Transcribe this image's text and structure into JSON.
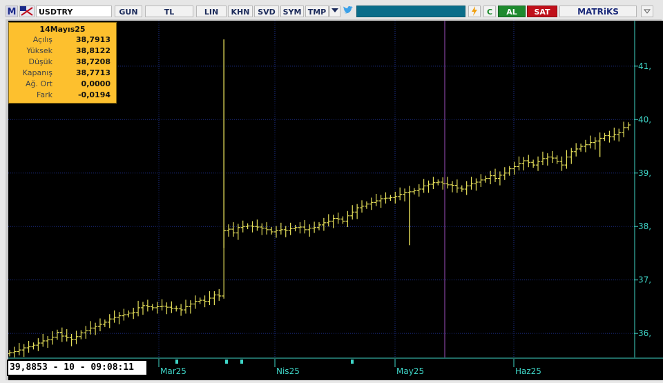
{
  "toolbar": {
    "logo": "M",
    "symbol": "USDTRY",
    "buttons": [
      "GUN",
      "TL",
      "LIN",
      "KHN",
      "SVD",
      "SYM",
      "TMP"
    ],
    "refresh": "C",
    "buy": "AL",
    "sell": "SAT",
    "brand": "MATRiKS"
  },
  "info_box": {
    "date": "14Mayıs25",
    "rows": [
      {
        "label": "Açılış",
        "value": "38,7913"
      },
      {
        "label": "Yüksek",
        "value": "38,8122"
      },
      {
        "label": "Düşük",
        "value": "38,7208"
      },
      {
        "label": "Kapanış",
        "value": "38,7713"
      },
      {
        "label": "Ağ. Ort",
        "value": "0,0000"
      },
      {
        "label": "Fark",
        "value": "-0,0194"
      }
    ]
  },
  "status": "39,8853 - 10 - 09:08:11",
  "colors": {
    "price": "#e6e05a",
    "grid": "#1e2f8a",
    "axis": "#3fd6c8",
    "cursor": "#a050c0"
  },
  "chart_data": {
    "type": "ohlc",
    "title": "USDTRY",
    "yticks": [
      {
        "value": 41,
        "label": "41,"
      },
      {
        "value": 40,
        "label": "40,"
      },
      {
        "value": 39,
        "label": "39,"
      },
      {
        "value": 38,
        "label": "38,"
      },
      {
        "value": 37,
        "label": "37,"
      },
      {
        "value": 36,
        "label": "36,"
      }
    ],
    "xticks": [
      "Mar25",
      "Nis25",
      "May25",
      "Haz25"
    ],
    "ylim": [
      35.55,
      41.85
    ],
    "grid": true,
    "closes": [
      35.64,
      35.66,
      35.69,
      35.73,
      35.75,
      35.78,
      35.82,
      35.86,
      35.88,
      35.93,
      36.02,
      35.95,
      35.92,
      35.89,
      35.94,
      36.01,
      36.05,
      36.1,
      36.13,
      36.17,
      36.21,
      36.27,
      36.3,
      36.33,
      36.35,
      36.38,
      36.39,
      36.48,
      36.52,
      36.5,
      36.48,
      36.5,
      36.51,
      36.49,
      36.47,
      36.46,
      36.44,
      36.5,
      36.55,
      36.6,
      36.62,
      36.6,
      36.66,
      36.72,
      36.7,
      37.92,
      37.95,
      37.88,
      37.98,
      38.0,
      38.01,
      38.0,
      37.99,
      37.97,
      37.94,
      37.9,
      37.92,
      37.94,
      37.93,
      37.96,
      37.98,
      37.99,
      37.94,
      37.97,
      37.98,
      38.03,
      38.07,
      38.1,
      38.15,
      38.14,
      38.1,
      38.2,
      38.27,
      38.35,
      38.38,
      38.42,
      38.45,
      38.48,
      38.52,
      38.53,
      38.54,
      38.56,
      38.6,
      38.64,
      38.65,
      38.67,
      38.7,
      38.76,
      38.79,
      38.82,
      38.83,
      38.8,
      38.78,
      38.77,
      38.72,
      38.7,
      38.76,
      38.8,
      38.83,
      38.87,
      38.9,
      38.95,
      38.9,
      38.96,
      39.0,
      39.08,
      39.12,
      39.18,
      39.23,
      39.2,
      39.15,
      39.22,
      39.27,
      39.3,
      39.28,
      39.22,
      39.15,
      39.3,
      39.4,
      39.45,
      39.5,
      39.53,
      39.57,
      39.6,
      39.65,
      39.7,
      39.68,
      39.72,
      39.76,
      39.85,
      39.9
    ]
  }
}
